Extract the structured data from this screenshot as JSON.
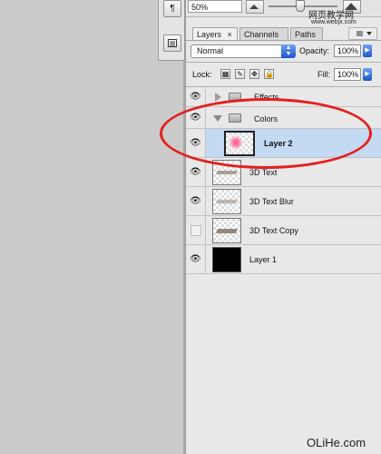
{
  "navigator": {
    "zoom_value": "50%"
  },
  "watermark_top": {
    "line1": "网页教学网",
    "line2": "www.webjx.com"
  },
  "watermark_bottom": "OLiHe.com",
  "tabs": [
    {
      "label": "Layers",
      "close": "×"
    },
    {
      "label": "Channels"
    },
    {
      "label": "Paths"
    }
  ],
  "blend_mode": "Normal",
  "opacity": {
    "label": "Opacity:",
    "value": "100%"
  },
  "lock": {
    "label": "Lock:"
  },
  "fill": {
    "label": "Fill:",
    "value": "100%"
  },
  "layers": [
    {
      "name": "Effects",
      "type": "group-collapsed",
      "visible": false
    },
    {
      "name": "Colors",
      "type": "group-expanded",
      "visible": true
    },
    {
      "name": "Layer 2",
      "type": "layer",
      "visible": true,
      "selected": true
    },
    {
      "name": "3D Text",
      "type": "layer",
      "visible": true
    },
    {
      "name": "3D Text Blur",
      "type": "layer",
      "visible": true
    },
    {
      "name": "3D Text Copy",
      "type": "layer",
      "visible": false
    },
    {
      "name": "Layer 1",
      "type": "layer",
      "visible": true
    }
  ],
  "colors": {
    "selection": "#c4d9f2",
    "annotation_oval": "#e32020",
    "aqua_blue": "#3a78e0"
  }
}
